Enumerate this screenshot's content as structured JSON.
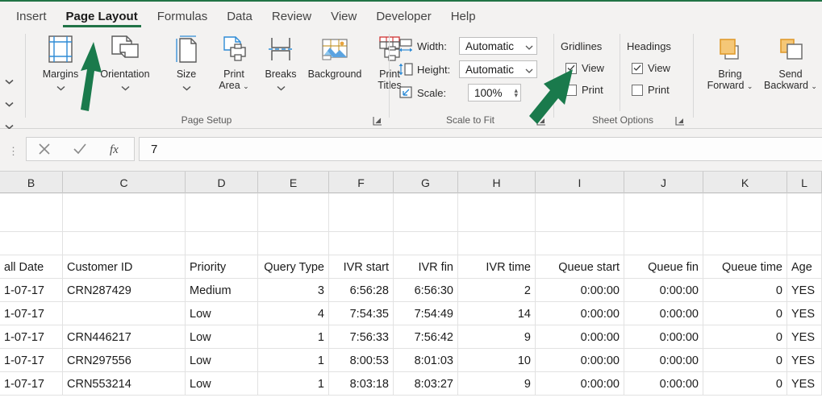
{
  "ribbon": {
    "tabs": [
      {
        "label": "Insert",
        "active": false
      },
      {
        "label": "Page Layout",
        "active": true
      },
      {
        "label": "Formulas",
        "active": false
      },
      {
        "label": "Data",
        "active": false
      },
      {
        "label": "Review",
        "active": false
      },
      {
        "label": "View",
        "active": false
      },
      {
        "label": "Developer",
        "active": false
      },
      {
        "label": "Help",
        "active": false
      }
    ],
    "accent_color": "#217346",
    "background_color": "#f3f2f1",
    "groups": {
      "page_setup": {
        "label": "Page Setup",
        "buttons": [
          {
            "label": "Margins",
            "icon": "margins-icon",
            "has_dropdown": true
          },
          {
            "label": "Orientation",
            "icon": "orientation-icon",
            "has_dropdown": true
          },
          {
            "label": "Size",
            "icon": "size-icon",
            "has_dropdown": true
          },
          {
            "label": "Print Area",
            "icon": "print-area-icon",
            "has_dropdown": true
          },
          {
            "label": "Breaks",
            "icon": "breaks-icon",
            "has_dropdown": true
          },
          {
            "label": "Background",
            "icon": "background-icon",
            "has_dropdown": false
          },
          {
            "label": "Print Titles",
            "icon": "print-titles-icon",
            "has_dropdown": false
          }
        ]
      },
      "scale_to_fit": {
        "label": "Scale to Fit",
        "width": {
          "label": "Width:",
          "value": "Automatic",
          "icon": "width-icon"
        },
        "height": {
          "label": "Height:",
          "value": "Automatic",
          "icon": "height-icon"
        },
        "scale": {
          "label": "Scale:",
          "value": "100%",
          "icon": "scale-icon"
        }
      },
      "sheet_options": {
        "label": "Sheet Options",
        "columns": [
          {
            "header": "Gridlines",
            "options": [
              {
                "label": "View",
                "checked": true
              },
              {
                "label": "Print",
                "checked": false
              }
            ]
          },
          {
            "header": "Headings",
            "options": [
              {
                "label": "View",
                "checked": true
              },
              {
                "label": "Print",
                "checked": false
              }
            ]
          }
        ]
      },
      "arrange": {
        "buttons": [
          {
            "label": "Bring Forward",
            "icon": "bring-forward-icon",
            "has_dropdown": true
          },
          {
            "label": "Send Backward",
            "icon": "send-backward-icon",
            "has_dropdown": true
          }
        ]
      }
    },
    "annotations": [
      {
        "name": "green-arrow-orientation",
        "color": "#1a7a4c"
      },
      {
        "name": "green-arrow-gridlines-view",
        "color": "#1a7a4c"
      }
    ]
  },
  "formula_bar": {
    "cancel_icon": "cancel-icon",
    "confirm_icon": "confirm-icon",
    "function_icon": "insert-function-icon",
    "value": "7"
  },
  "grid": {
    "column_headers": [
      "B",
      "C",
      "D",
      "E",
      "F",
      "G",
      "H",
      "I",
      "J",
      "K",
      "L"
    ],
    "header_row": [
      "all Date",
      "Customer ID",
      "Priority",
      "Query Type",
      "IVR start",
      "IVR fin",
      "IVR time",
      "Queue start",
      "Queue fin",
      "Queue time",
      "Age"
    ],
    "empty_rows": 2,
    "rows": [
      [
        "1-07-17",
        "CRN287429",
        "Medium",
        "3",
        "6:56:28",
        "6:56:30",
        "2",
        "0:00:00",
        "0:00:00",
        "0",
        "YES"
      ],
      [
        "1-07-17",
        "",
        "Low",
        "4",
        "7:54:35",
        "7:54:49",
        "14",
        "0:00:00",
        "0:00:00",
        "0",
        "YES"
      ],
      [
        "1-07-17",
        "CRN446217",
        "Low",
        "1",
        "7:56:33",
        "7:56:42",
        "9",
        "0:00:00",
        "0:00:00",
        "0",
        "YES"
      ],
      [
        "1-07-17",
        "CRN297556",
        "Low",
        "1",
        "8:00:53",
        "8:01:03",
        "10",
        "0:00:00",
        "0:00:00",
        "0",
        "YES"
      ],
      [
        "1-07-17",
        "CRN553214",
        "Low",
        "1",
        "8:03:18",
        "8:03:27",
        "9",
        "0:00:00",
        "0:00:00",
        "0",
        "YES"
      ]
    ],
    "alignments": [
      "left",
      "left",
      "left",
      "right",
      "right",
      "right",
      "right",
      "right",
      "right",
      "right",
      "left"
    ]
  }
}
